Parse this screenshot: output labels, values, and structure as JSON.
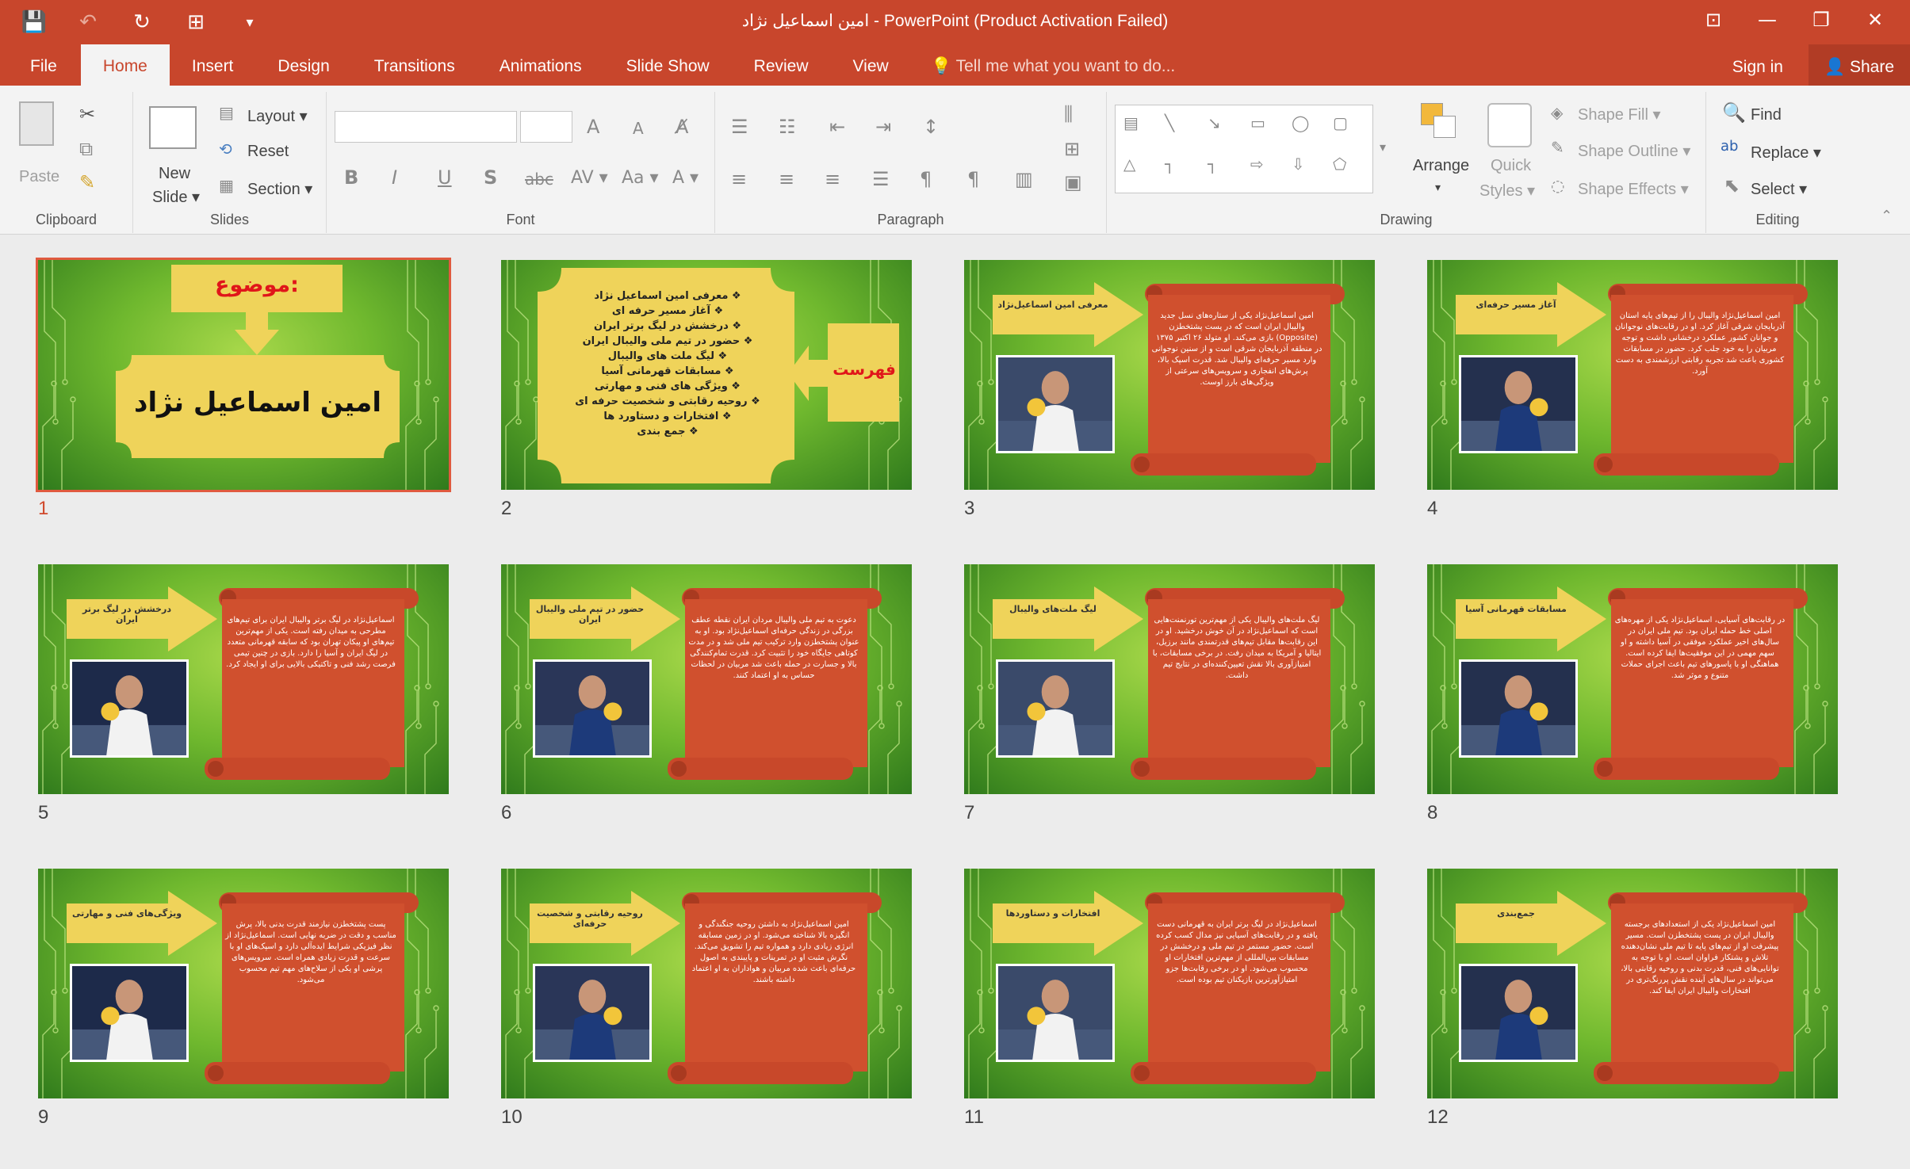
{
  "window": {
    "title": "امین اسماعیل نژاد - PowerPoint (Product Activation Failed)",
    "controls": [
      "⊡",
      "—",
      "❐",
      "✕"
    ]
  },
  "qat": {
    "save": "💾",
    "undo": "↶",
    "redo": "↻",
    "present": "⊞",
    "more": "▾"
  },
  "tabs": [
    {
      "label": "File"
    },
    {
      "label": "Home"
    },
    {
      "label": "Insert"
    },
    {
      "label": "Design"
    },
    {
      "label": "Transitions"
    },
    {
      "label": "Animations"
    },
    {
      "label": "Slide Show"
    },
    {
      "label": "Review"
    },
    {
      "label": "View"
    }
  ],
  "tellme": "Tell me what you want to do...",
  "signin": "Sign in",
  "share": "Share",
  "ribbon": {
    "clipboard": {
      "label": "Clipboard",
      "paste": "Paste"
    },
    "slides": {
      "label": "Slides",
      "new_slide_1": "New",
      "new_slide_2": "Slide ▾",
      "layout": "Layout ▾",
      "reset": "Reset",
      "section": "Section ▾"
    },
    "font": {
      "label": "Font",
      "bold": "B",
      "italic": "I",
      "underline": "U",
      "shadow": "S",
      "strike": "abc",
      "spacing": "AV ▾",
      "case": "Aa ▾",
      "color": "A ▾",
      "grow": "A",
      "shrink": "A"
    },
    "paragraph": {
      "label": "Paragraph"
    },
    "drawing": {
      "label": "Drawing",
      "arrange": "Arrange",
      "arrange_dd": "▾",
      "quick1": "Quick",
      "quick2": "Styles ▾",
      "shape_fill": "Shape Fill ▾",
      "shape_outline": "Shape Outline ▾",
      "shape_effects": "Shape Effects ▾"
    },
    "editing": {
      "label": "Editing",
      "find": "Find",
      "replace": "Replace ▾",
      "select": "Select ▾"
    }
  },
  "slides": [
    {
      "num": "1",
      "kind": "title",
      "top": "موضوع:",
      "main": "امین اسماعیل نژاد"
    },
    {
      "num": "2",
      "kind": "toc",
      "box": "فهرست",
      "items": [
        "معرفی امین اسماعیل نژاد",
        "آغاز مسیر حرفه ای",
        "درخشش در لیگ برتر ایران",
        "حضور در تیم ملی والیبال ایران",
        "لیگ ملت های والیبال",
        "مسابقات قهرمانی آسیا",
        "ویژگی های فنی و مهارتی",
        "روحیه رقابتی و شخصیت حرفه ای",
        "افتخارات و دستاورد ها",
        "جمع بندی"
      ]
    },
    {
      "num": "3",
      "kind": "content",
      "arrow": "معرفی امین اسماعیل‌نژاد",
      "body": "امین اسماعیل‌نژاد یکی از ستاره‌های نسل جدید والیبال ایران است که در پست پشتخطزن (Opposite) بازی می‌کند. او متولد ۲۶ اکتبر ۱۳۷۵ در منطقه آذربایجان شرقی است و از سنین نوجوانی وارد مسیر حرفه‌ای والیبال شد. قدرت اسپک بالا، پرش‌های انفجاری و سرویس‌های سرعتی از ویژگی‌های بارز اوست."
    },
    {
      "num": "4",
      "kind": "content",
      "arrow": "آغاز مسیر حرفه‌ای",
      "body": "امین اسماعیل‌نژاد والیبال را از تیم‌های پایه استان آذربایجان شرقی آغاز کرد. او در رقابت‌های نوجوانان و جوانان کشور عملکرد درخشانی داشت و توجه مربیان را به خود جلب کرد. حضور در مسابقات کشوری باعث شد تجربه رقابتی ارزشمندی به دست آورد."
    },
    {
      "num": "5",
      "kind": "content",
      "arrow": "درخشش در لیگ برتر ایران",
      "body": "اسماعیل‌نژاد در لیگ برتر والیبال ایران برای تیم‌های مطرحی به میدان رفته است. یکی از مهم‌ترین تیم‌های او پیکان تهران بود که سابقه قهرمانی متعدد در لیگ ایران و آسیا را دارد. بازی در چنین تیمی فرصت رشد فنی و تاکتیکی بالایی برای او ایجاد کرد."
    },
    {
      "num": "6",
      "kind": "content",
      "arrow": "حضور در تیم ملی والیبال ایران",
      "body": "دعوت به تیم ملی والیبال مردان ایران نقطه عطف بزرگی در زندگی حرفه‌ای اسماعیل‌نژاد بود. او به عنوان پشتخطزن وارد ترکیب تیم ملی شد و در مدت کوتاهی جایگاه خود را تثبیت کرد. قدرت تمام‌کنندگی بالا و جسارت در حمله باعث شد مربیان در لحظات حساس به او اعتماد کنند."
    },
    {
      "num": "7",
      "kind": "content",
      "arrow": "لیگ ملت‌های والیبال",
      "body": "لیگ ملت‌های والیبال یکی از مهم‌ترین تورنمنت‌هایی است که اسماعیل‌نژاد در آن خوش درخشید. او در این رقابت‌ها مقابل تیم‌های قدرتمندی مانند برزیل، ایتالیا و آمریکا به میدان رفت. در برخی مسابقات، با امتیازآوری بالا نقش تعیین‌کننده‌ای در نتایج تیم داشت."
    },
    {
      "num": "8",
      "kind": "content",
      "arrow": "مسابقات قهرمانی آسیا",
      "body": "در رقابت‌های آسیایی، اسماعیل‌نژاد یکی از مهره‌های اصلی خط حمله ایران بود. تیم ملی ایران در سال‌های اخیر عملکرد موفقی در آسیا داشته و او سهم مهمی در این موفقیت‌ها ایفا کرده است. هماهنگی او با پاسورهای تیم باعث اجرای حملات متنوع و موثر شد."
    },
    {
      "num": "9",
      "kind": "content",
      "arrow": "ویژگی‌های فنی و مهارتی",
      "body": "پست پشتخطزن نیازمند قدرت بدنی بالا، پرش مناسب و دقت در ضربه نهایی است. اسماعیل‌نژاد از نظر فیزیکی شرایط ایده‌آلی دارد و اسپک‌های او با سرعت و قدرت زیادی همراه است. سرویس‌های پرشی او یکی از سلاح‌های مهم تیم محسوب می‌شود."
    },
    {
      "num": "10",
      "kind": "content",
      "arrow": "روحیه رقابتی و شخصیت حرفه‌ای",
      "body": "امین اسماعیل‌نژاد به داشتن روحیه جنگندگی و انگیزه بالا شناخته می‌شود. او در زمین مسابقه انرژی زیادی دارد و همواره تیم را تشویق می‌کند. نگرش مثبت او در تمرینات و پایبندی به اصول حرفه‌ای باعث شده مربیان و هواداران به او اعتماد داشته باشند."
    },
    {
      "num": "11",
      "kind": "content",
      "arrow": "افتخارات و دستاوردها",
      "body": "اسماعیل‌نژاد در لیگ برتر ایران به قهرمانی دست یافته و در رقابت‌های آسیایی نیز مدال کسب کرده است. حضور مستمر در تیم ملی و درخشش در مسابقات بین‌المللی از مهم‌ترین افتخارات او محسوب می‌شود. او در برخی رقابت‌ها جزو امتیازآورترین بازیکنان تیم بوده است."
    },
    {
      "num": "12",
      "kind": "content",
      "arrow": "جمع‌بندی",
      "body": "امین اسماعیل‌نژاد یکی از استعدادهای برجسته والیبال ایران در پست پشتخطزن است. مسیر پیشرفت او از تیم‌های پایه تا تیم ملی نشان‌دهنده تلاش و پشتکار فراوان است. او با توجه به توانایی‌های فنی، قدرت بدنی و روحیه رقابتی بالا، می‌تواند در سال‌های آینده نقش پررنگ‌تری در افتخارات والیبال ایران ایفا کند."
    }
  ]
}
